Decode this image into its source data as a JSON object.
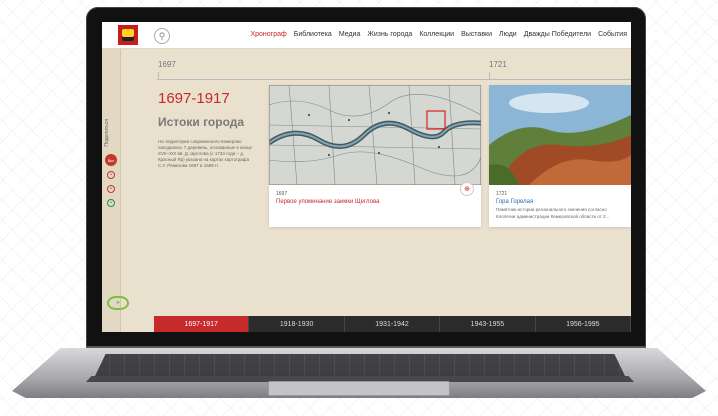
{
  "header": {
    "nav": [
      "Хронограф",
      "Библиотека",
      "Медиа",
      "Жизнь города",
      "Коллекции",
      "Выставки",
      "Люди",
      "Дважды Победители",
      "События"
    ],
    "active_nav": "Хронограф"
  },
  "sidebar": {
    "vertical_text": "Поделиться",
    "badge": "Вкс"
  },
  "ruler": {
    "left_year": "1697",
    "right_year": "1721"
  },
  "intro": {
    "period": "1697-1917",
    "title": "Истоки города",
    "description": "На территории современного Кемерово находились 7 деревень, основанные в конце XVII–XIX вв. Д. Щеглова (с 1734 года – д. Красный Яр) указана на картах картографа С.У. Ремезова 1697 и 1698 гг."
  },
  "cards": [
    {
      "year": "1697",
      "title": "Первое упоминание заимки Щеглова"
    },
    {
      "year": "1721",
      "title": "Гора Горелая",
      "sub1": "Памятник истории регионального значения согласно",
      "sub2": "Коллегии администрации Кемеровской области от 2..."
    }
  ],
  "timeline": [
    "1697-1917",
    "1918-1930",
    "1931-1942",
    "1943-1955",
    "1956-1995"
  ],
  "timeline_active": "1697-1917",
  "colors": {
    "accent": "#c62a2a",
    "background": "#e9e1cd",
    "link": "#2b6aa8"
  }
}
